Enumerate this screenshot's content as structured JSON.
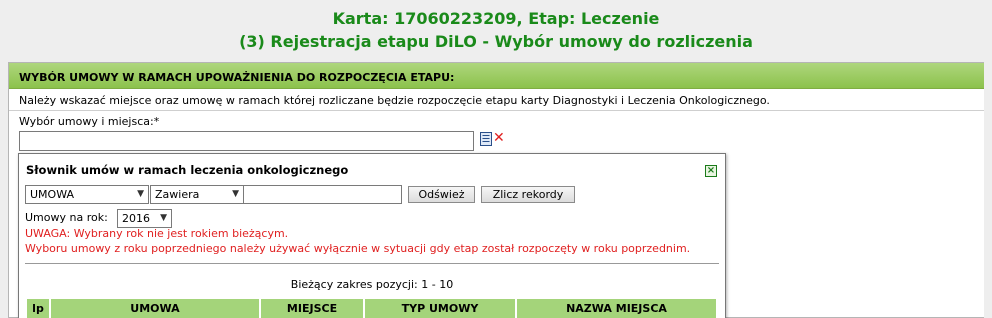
{
  "header": {
    "line1": "Karta: 17060223209, Etap: Leczenie",
    "line2": "(3) Rejestracja etapu DiLO - Wybór umowy do rozliczenia"
  },
  "panel": {
    "title": "WYBÓR UMOWY W RAMACH UPOWAŻNIENIA DO ROZPOCZĘCIA ETAPU:",
    "info": "Należy wskazać miejsce oraz umowę w ramach której rozliczane będzie rozpoczęcie etapu karty Diagnostyki i Leczenia Onkologicznego.",
    "field_label": "Wybór umowy i miejsca:*",
    "field_value": ""
  },
  "popup": {
    "title": "Słownik umów w ramach leczenia onkologicznego",
    "filter_field": "UMOWA",
    "filter_operator": "Zawiera",
    "filter_value": "",
    "refresh_label": "Odśwież",
    "count_label": "Zlicz rekordy",
    "year_label": "Umowy na rok:",
    "year_value": "2016",
    "warning1": "UWAGA: Wybrany rok nie jest rokiem bieżącym.",
    "warning2": "Wyboru umowy z roku poprzedniego należy używać wyłącznie w sytuacji gdy etap został rozpoczęty w roku poprzednim.",
    "range_text": "Bieżący zakres pozycji: 1 - 10",
    "columns": [
      "lp",
      "UMOWA",
      "MIEJSCE",
      "TYP UMOWY",
      "NAZWA MIEJSCA"
    ]
  },
  "colors": {
    "title_green": "#1a8a1a",
    "header_green": "#8cc24c",
    "table_head_green": "#a4d47a",
    "warning_red": "#e02020"
  },
  "icons": {
    "list": "list-icon",
    "clear": "clear-icon",
    "close": "close-icon"
  }
}
